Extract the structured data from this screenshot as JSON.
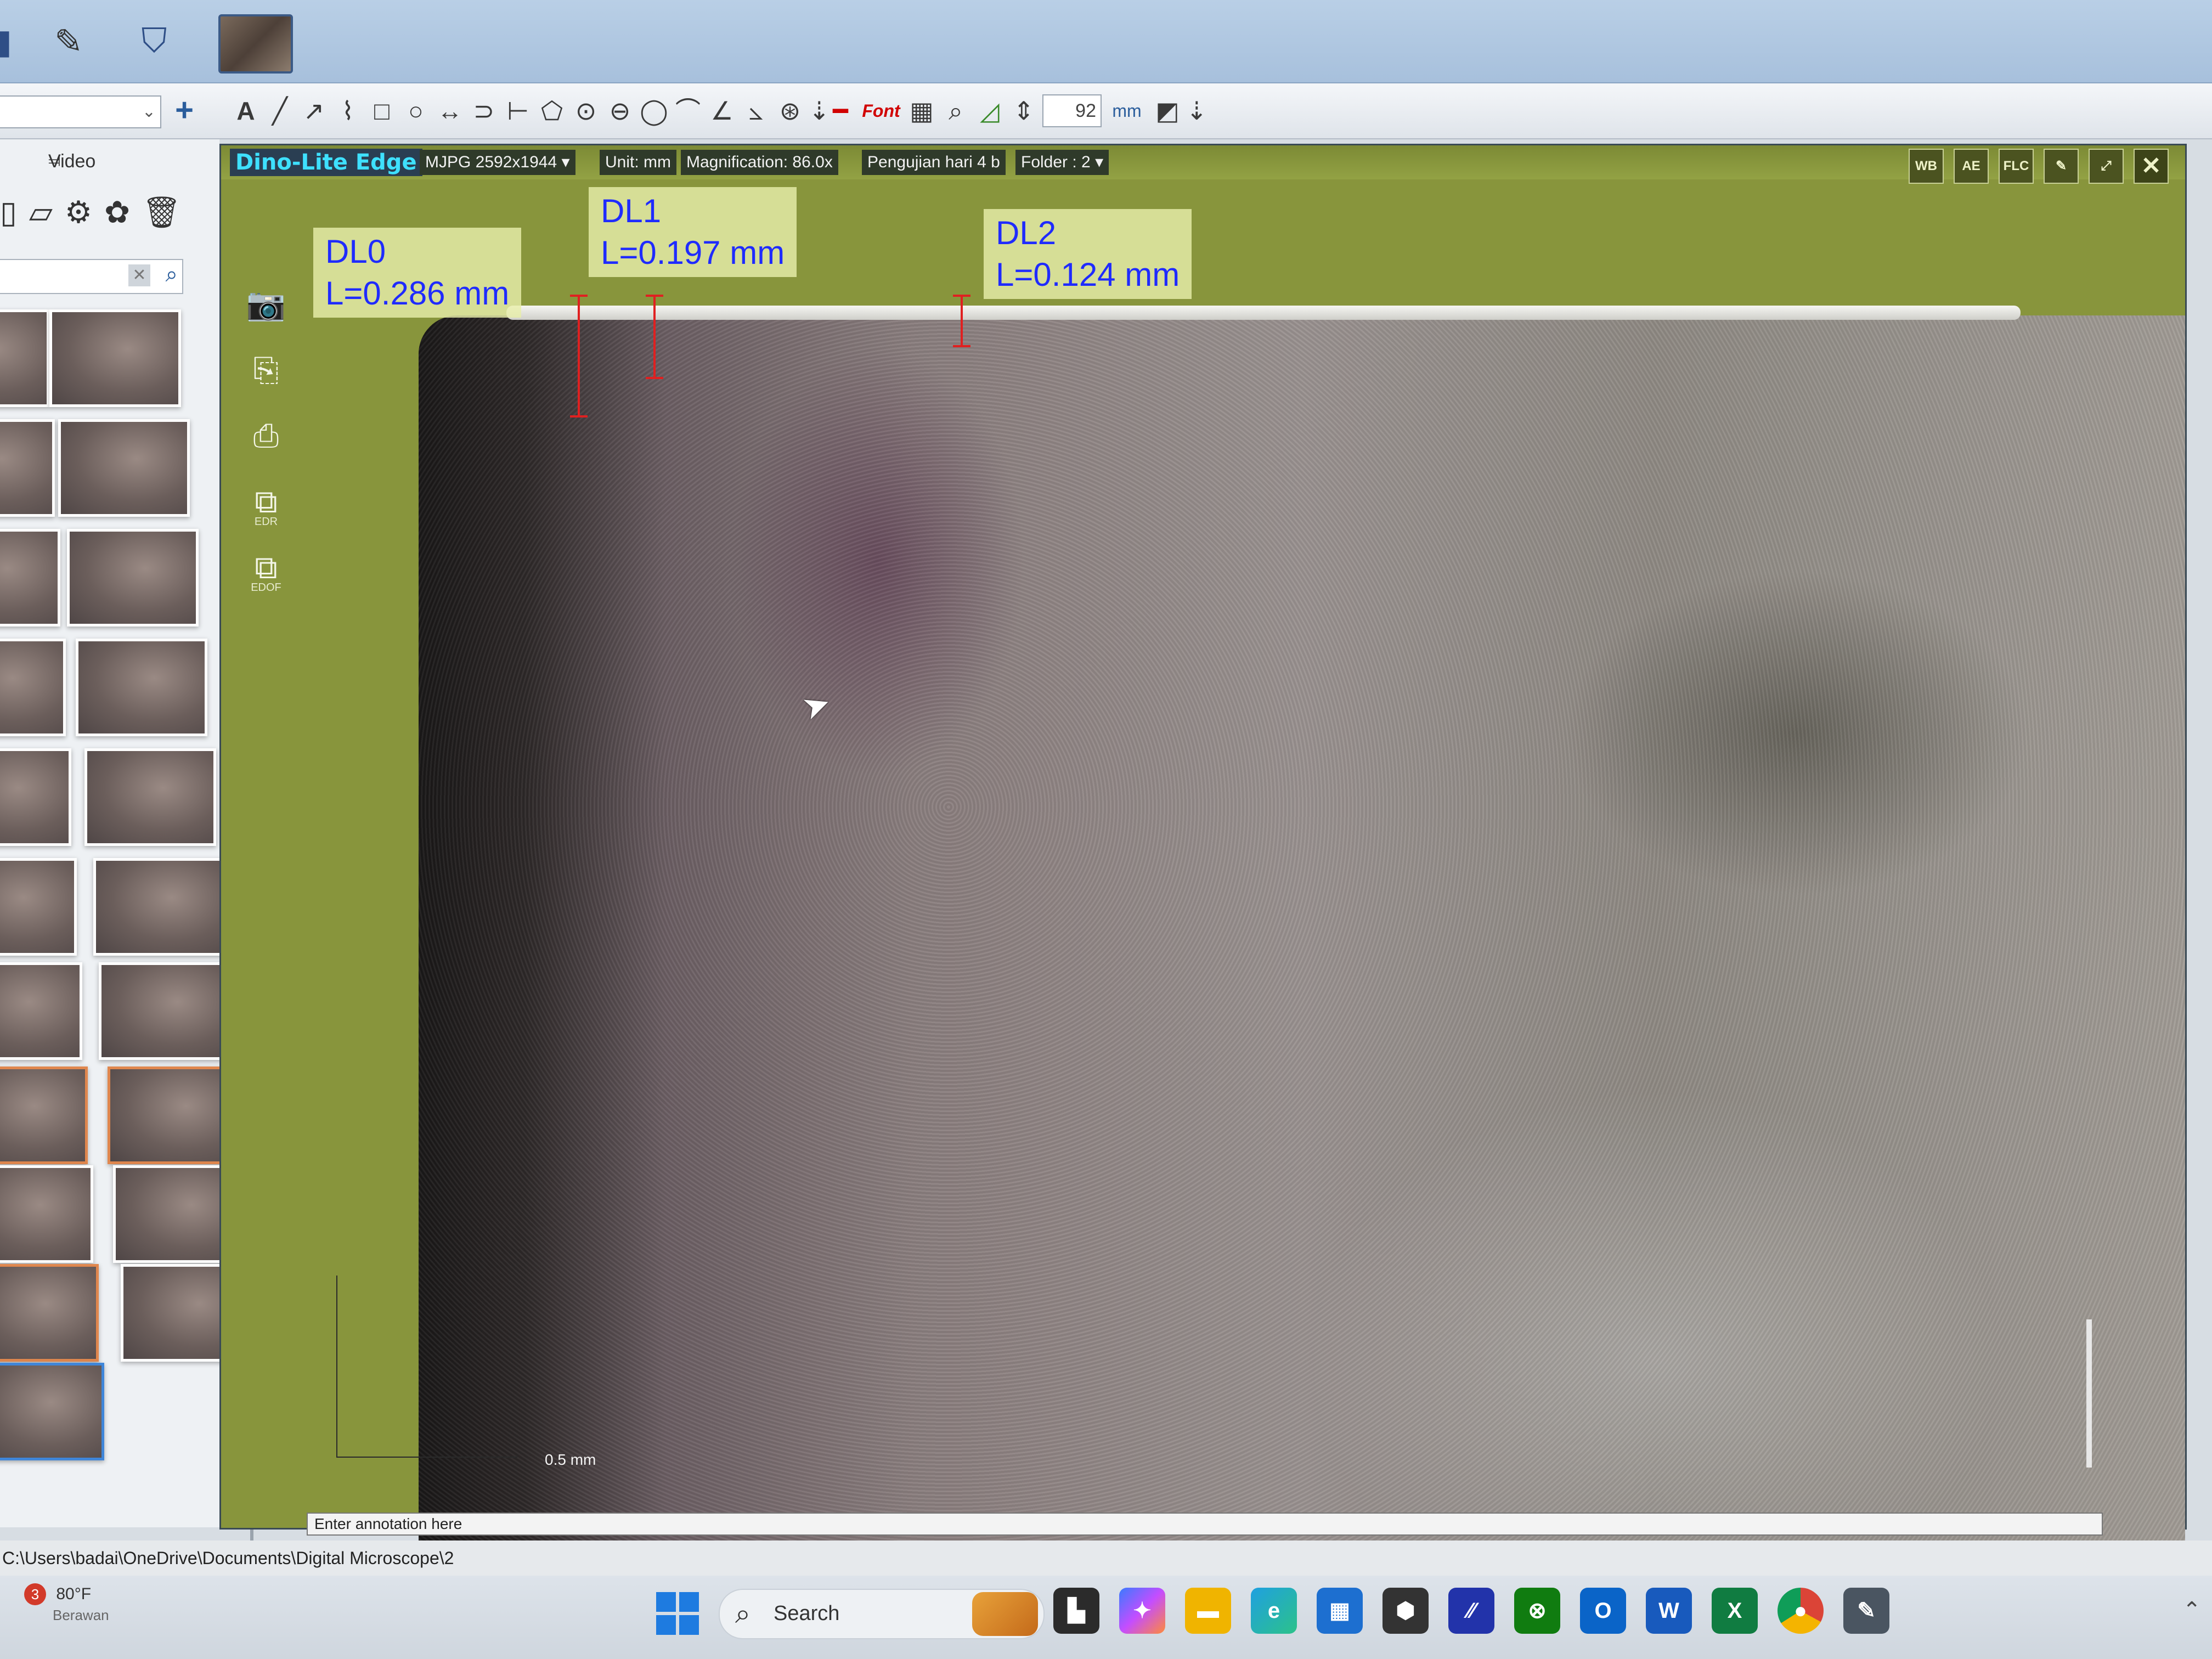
{
  "titlebar": {
    "left_icons": [
      "pen-icon",
      "shield-icon"
    ],
    "active_thumb": "image-thumb"
  },
  "toolbar": {
    "combo_value": "",
    "zoom_value": "92",
    "unit_label": "mm",
    "font_label": "Font",
    "text_tool": "A"
  },
  "left_panel": {
    "header": "Video",
    "thumbnail_count": 19,
    "selected_thumbnail_index": 18
  },
  "viewer": {
    "brand": "Dino-Lite Edge",
    "resolution": "MJPG 2592x1944",
    "unit": "Unit: mm",
    "magnification": "Magnification:  86.0x",
    "session": "Pengujian hari 4 b",
    "folder": "Folder : 2",
    "right_icons": [
      "WB",
      "AE",
      "FLC"
    ],
    "side_tools": {
      "edr": "EDR",
      "edof": "EDOF"
    },
    "measurements": [
      {
        "id": "DL0",
        "label": "DL0",
        "value": "L=0.286 mm"
      },
      {
        "id": "DL1",
        "label": "DL1",
        "value": "L=0.197 mm"
      },
      {
        "id": "DL2",
        "label": "DL2",
        "value": "L=0.124 mm"
      }
    ],
    "scale_bar": "0.5 mm",
    "annotation_placeholder": "Enter annotation here"
  },
  "path": "C:\\Users\\badai\\OneDrive\\Documents\\Digital Microscope\\2",
  "taskbar": {
    "weather_badge": "3",
    "temperature": "80°F",
    "condition": "Berawan",
    "search_label": "Search",
    "apps": [
      "task-view",
      "copilot",
      "file-explorer",
      "edge",
      "store",
      "app-dark",
      "app-blue",
      "xbox",
      "outlook",
      "word",
      "excel",
      "chrome",
      "microscope-app"
    ]
  }
}
